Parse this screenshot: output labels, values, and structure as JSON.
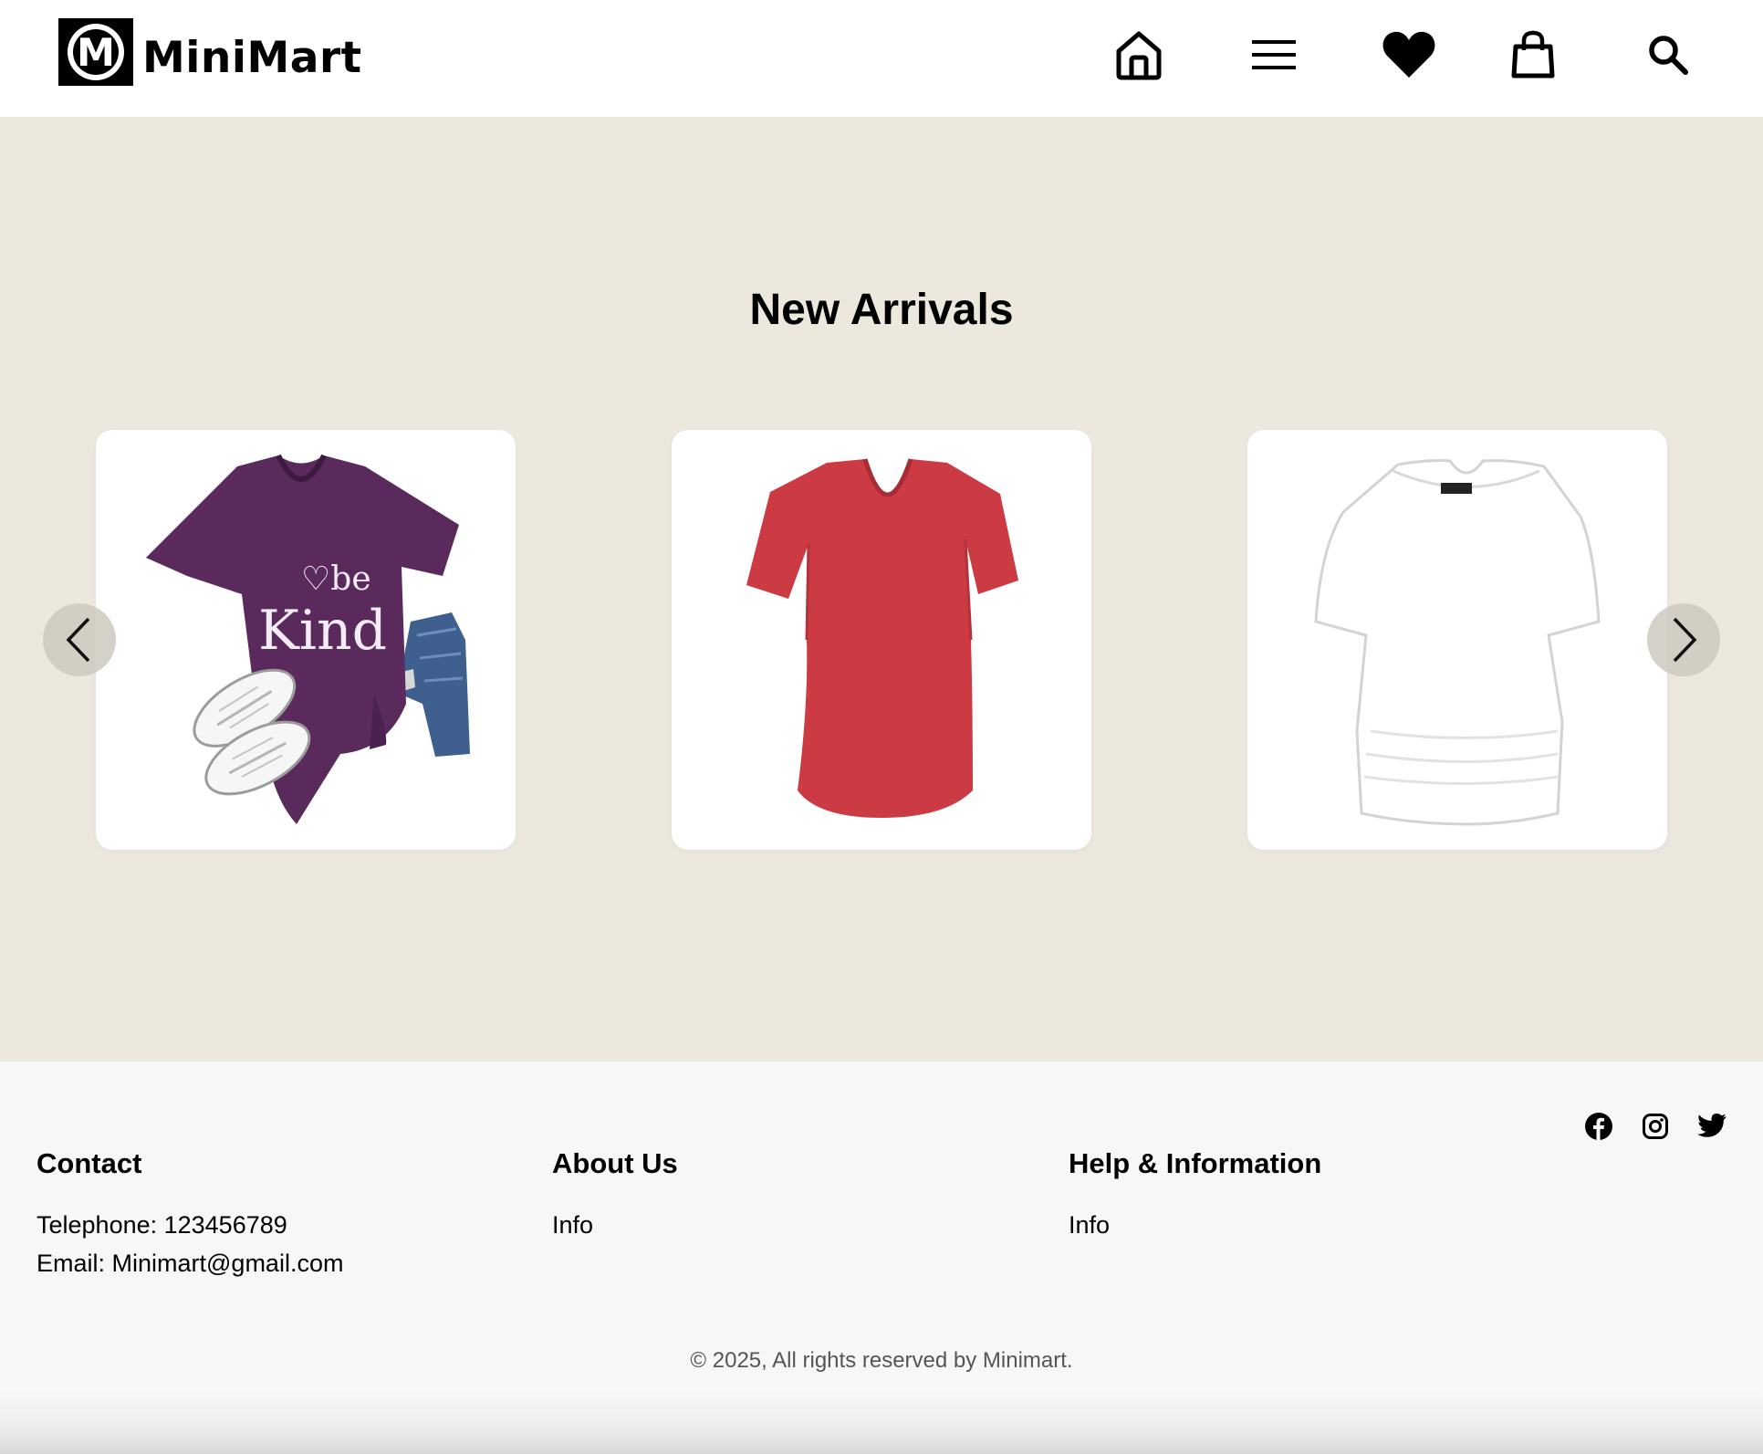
{
  "header": {
    "brand": "MiniMart",
    "logo_letter": "M",
    "nav": [
      {
        "name": "home",
        "icon": "home-icon"
      },
      {
        "name": "menu",
        "icon": "hamburger-menu-icon"
      },
      {
        "name": "wishlist",
        "icon": "heart-icon"
      },
      {
        "name": "cart",
        "icon": "shopping-bag-icon"
      },
      {
        "name": "search",
        "icon": "search-icon"
      }
    ]
  },
  "new_arrivals": {
    "title": "New Arrivals",
    "products": [
      {
        "image": "purple v-neck tee with sneakers and jeans",
        "print": "be kind"
      },
      {
        "image": "red v-neck tee"
      },
      {
        "image": "white scoop-neck dolman top"
      }
    ],
    "prev_icon": "chevron-left-icon",
    "next_icon": "chevron-right-icon"
  },
  "footer": {
    "contact": {
      "heading": "Contact",
      "telephone": "Telephone: 123456789",
      "email": "Email: Minimart@gmail.com"
    },
    "about": {
      "heading": "About Us",
      "link": "Info"
    },
    "help": {
      "heading": "Help & Information",
      "link": "Info"
    },
    "socials": [
      "facebook-icon",
      "instagram-icon",
      "twitter-icon"
    ],
    "copyright": "© 2025, All rights reserved by Minimart."
  },
  "colors": {
    "header_bg": "#ffffff",
    "section_bg": "#ede8dd",
    "footer_bg": "#f7f7f7",
    "text": "#000000",
    "muted_text": "#555555",
    "purple_shirt": "#5a2a5c",
    "red_shirt": "#cc3a44"
  }
}
